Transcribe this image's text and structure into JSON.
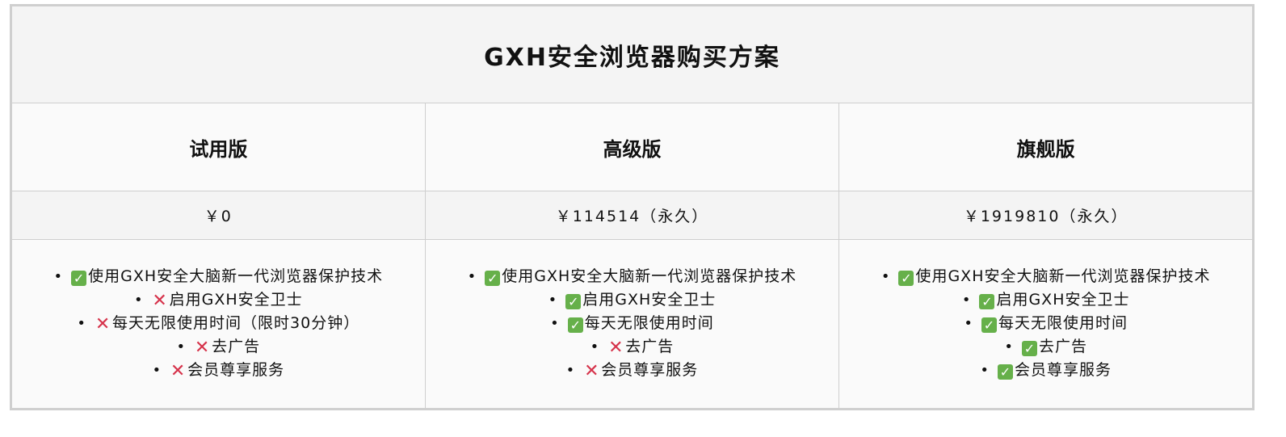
{
  "title": "GXH安全浏览器购买方案",
  "colors": {
    "check": "#66b04a",
    "cross": "#d6334b",
    "header_bg": "#f4f4f4",
    "cell_bg": "#fafafa",
    "border": "#cfcfcf"
  },
  "plans": [
    {
      "name": "试用版",
      "price": "￥0",
      "features": [
        {
          "status": "check",
          "icon": "check-mark-icon",
          "text": "使用GXH安全大脑新一代浏览器保护技术"
        },
        {
          "status": "cross",
          "icon": "cross-mark-icon",
          "text": "启用GXH安全卫士"
        },
        {
          "status": "cross",
          "icon": "cross-mark-icon",
          "text": "每天无限使用时间（限时30分钟）"
        },
        {
          "status": "cross",
          "icon": "cross-mark-icon",
          "text": "去广告"
        },
        {
          "status": "cross",
          "icon": "cross-mark-icon",
          "text": "会员尊享服务"
        }
      ]
    },
    {
      "name": "高级版",
      "price": "￥114514（永久）",
      "features": [
        {
          "status": "check",
          "icon": "check-mark-icon",
          "text": "使用GXH安全大脑新一代浏览器保护技术"
        },
        {
          "status": "check",
          "icon": "check-mark-icon",
          "text": "启用GXH安全卫士"
        },
        {
          "status": "check",
          "icon": "check-mark-icon",
          "text": "每天无限使用时间"
        },
        {
          "status": "cross",
          "icon": "cross-mark-icon",
          "text": "去广告"
        },
        {
          "status": "cross",
          "icon": "cross-mark-icon",
          "text": "会员尊享服务"
        }
      ]
    },
    {
      "name": "旗舰版",
      "price": "￥1919810（永久）",
      "features": [
        {
          "status": "check",
          "icon": "check-mark-icon",
          "text": "使用GXH安全大脑新一代浏览器保护技术"
        },
        {
          "status": "check",
          "icon": "check-mark-icon",
          "text": "启用GXH安全卫士"
        },
        {
          "status": "check",
          "icon": "check-mark-icon",
          "text": "每天无限使用时间"
        },
        {
          "status": "check",
          "icon": "check-mark-icon",
          "text": "去广告"
        },
        {
          "status": "check",
          "icon": "check-mark-icon",
          "text": "会员尊享服务"
        }
      ]
    }
  ]
}
